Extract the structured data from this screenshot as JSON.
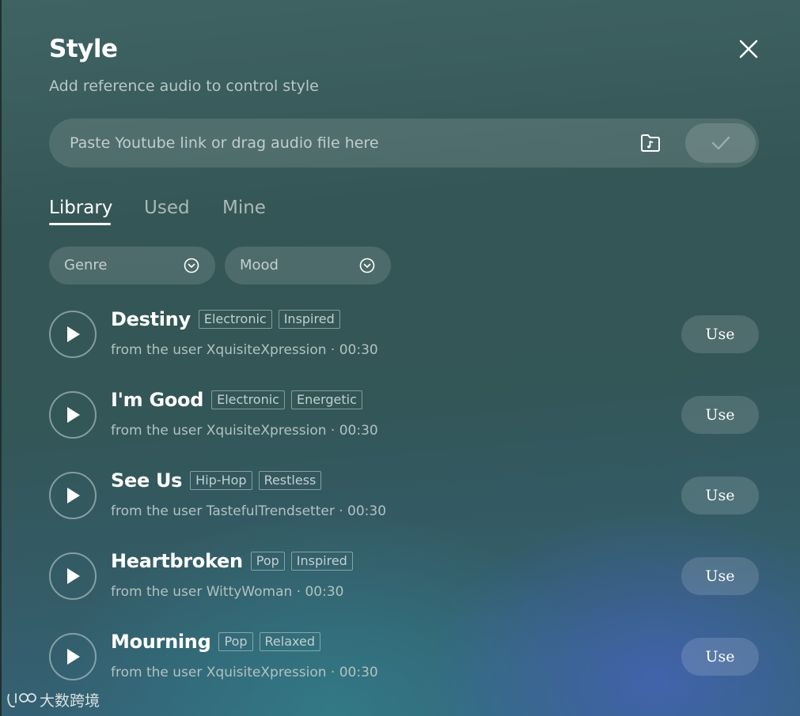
{
  "dialog": {
    "title": "Style",
    "subtitle": "Add reference audio to control style"
  },
  "upload": {
    "placeholder": "Paste Youtube link or drag audio file here",
    "value": ""
  },
  "tabs": [
    {
      "label": "Library",
      "active": true
    },
    {
      "label": "Used",
      "active": false
    },
    {
      "label": "Mine",
      "active": false
    }
  ],
  "filters": [
    {
      "label": "Genre"
    },
    {
      "label": "Mood"
    }
  ],
  "tracks": [
    {
      "title": "Destiny",
      "tags": [
        "Electronic",
        "Inspired"
      ],
      "meta": "from the user XquisiteXpression · 00:30",
      "action": "Use"
    },
    {
      "title": "I'm Good",
      "tags": [
        "Electronic",
        "Energetic"
      ],
      "meta": "from the user XquisiteXpression · 00:30",
      "action": "Use"
    },
    {
      "title": "See Us",
      "tags": [
        "Hip-Hop",
        "Restless"
      ],
      "meta": "from the user TastefulTrendsetter · 00:30",
      "action": "Use"
    },
    {
      "title": "Heartbroken",
      "tags": [
        "Pop",
        "Inspired"
      ],
      "meta": "from the user WittyWoman · 00:30",
      "action": "Use"
    },
    {
      "title": "Mourning",
      "tags": [
        "Pop",
        "Relaxed"
      ],
      "meta": "from the user XquisiteXpression · 00:30",
      "action": "Use"
    }
  ],
  "watermark": {
    "text": "大数跨境"
  },
  "icons": {
    "close": "close-icon",
    "folder": "music-folder-icon",
    "confirm": "check-icon",
    "chevron": "chevron-down-circle-icon",
    "play": "play-icon"
  }
}
